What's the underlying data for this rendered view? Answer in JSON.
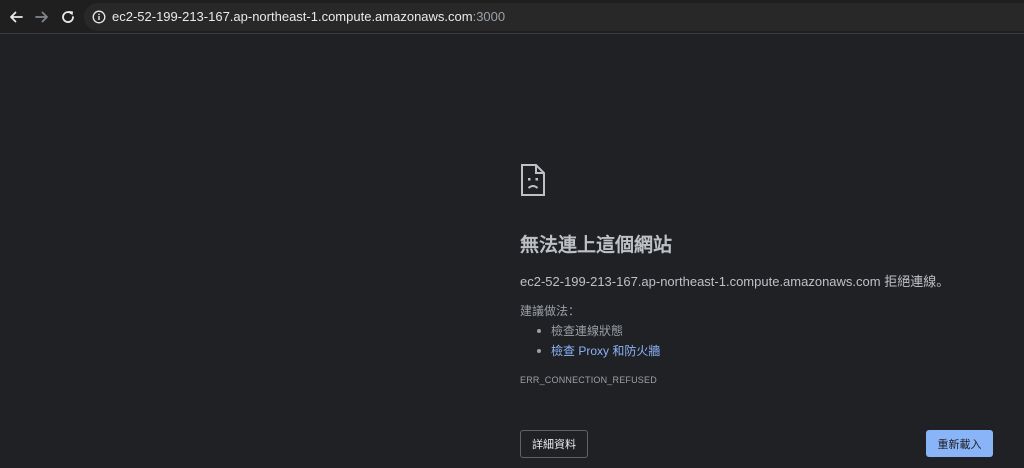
{
  "toolbar": {
    "back_icon": "arrow-left-icon",
    "forward_icon": "arrow-right-icon",
    "reload_icon": "reload-icon",
    "info_icon": "info-icon",
    "url_host": "ec2-52-199-213-167.ap-northeast-1.compute.amazonaws.com",
    "url_port": ":3000"
  },
  "error": {
    "icon": "sad-page-icon",
    "title": "無法連上這個網站",
    "message": "ec2-52-199-213-167.ap-northeast-1.compute.amazonaws.com 拒絕連線。",
    "suggestions_heading": "建議做法：",
    "suggestions": [
      {
        "label": "檢查連線狀態",
        "link": false
      },
      {
        "label": "檢查 Proxy 和防火牆",
        "link": true
      }
    ],
    "code": "ERR_CONNECTION_REFUSED"
  },
  "buttons": {
    "details_label": "詳細資料",
    "reload_label": "重新載入"
  },
  "colors": {
    "background": "#202124",
    "text": "#bdc1c6",
    "link": "#8ab4f8",
    "primary_button": "#8ab4f8"
  }
}
